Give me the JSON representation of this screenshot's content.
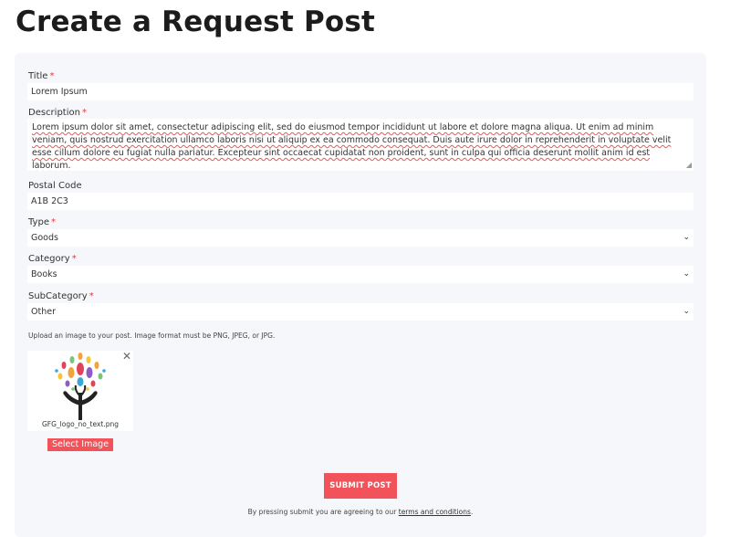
{
  "page": {
    "title": "Create a Request Post"
  },
  "form": {
    "required_mark": "*",
    "title": {
      "label": "Title",
      "value": "Lorem Ipsum"
    },
    "description": {
      "label": "Description",
      "value": "Lorem ipsum dolor sit amet, consectetur adipiscing elit, sed do eiusmod tempor incididunt ut labore et dolore magna aliqua. Ut enim ad minim veniam, quis nostrud exercitation ullamco laboris nisi ut aliquip ex ea commodo consequat. Duis aute irure dolor in reprehenderit in voluptate velit esse cillum dolore eu fugiat nulla pariatur. Excepteur sint occaecat cupidatat non proident, sunt in culpa qui officia deserunt mollit anim id est laborum."
    },
    "postal_code": {
      "label": "Postal Code",
      "value": "A1B 2C3"
    },
    "type": {
      "label": "Type",
      "value": "Goods"
    },
    "category": {
      "label": "Category",
      "value": "Books"
    },
    "subcategory": {
      "label": "SubCategory",
      "value": "Other"
    },
    "upload_hint": "Upload an image to your post. Image format must be PNG, JPEG, or JPG.",
    "image": {
      "filename": "GFG_logo_no_text.png",
      "close_glyph": "✕",
      "select_label": "Select Image"
    },
    "submit_label": "SUBMIT POST",
    "agreement": {
      "prefix": "By pressing submit you are agreeing to our ",
      "link": "terms and conditions",
      "suffix": "."
    }
  },
  "icons": {
    "select": "chevron-down-icon",
    "remove": "close-icon"
  },
  "colors": {
    "accent": "#f2525a",
    "required": "#e0373a",
    "card_bg": "#f6f7fb"
  }
}
